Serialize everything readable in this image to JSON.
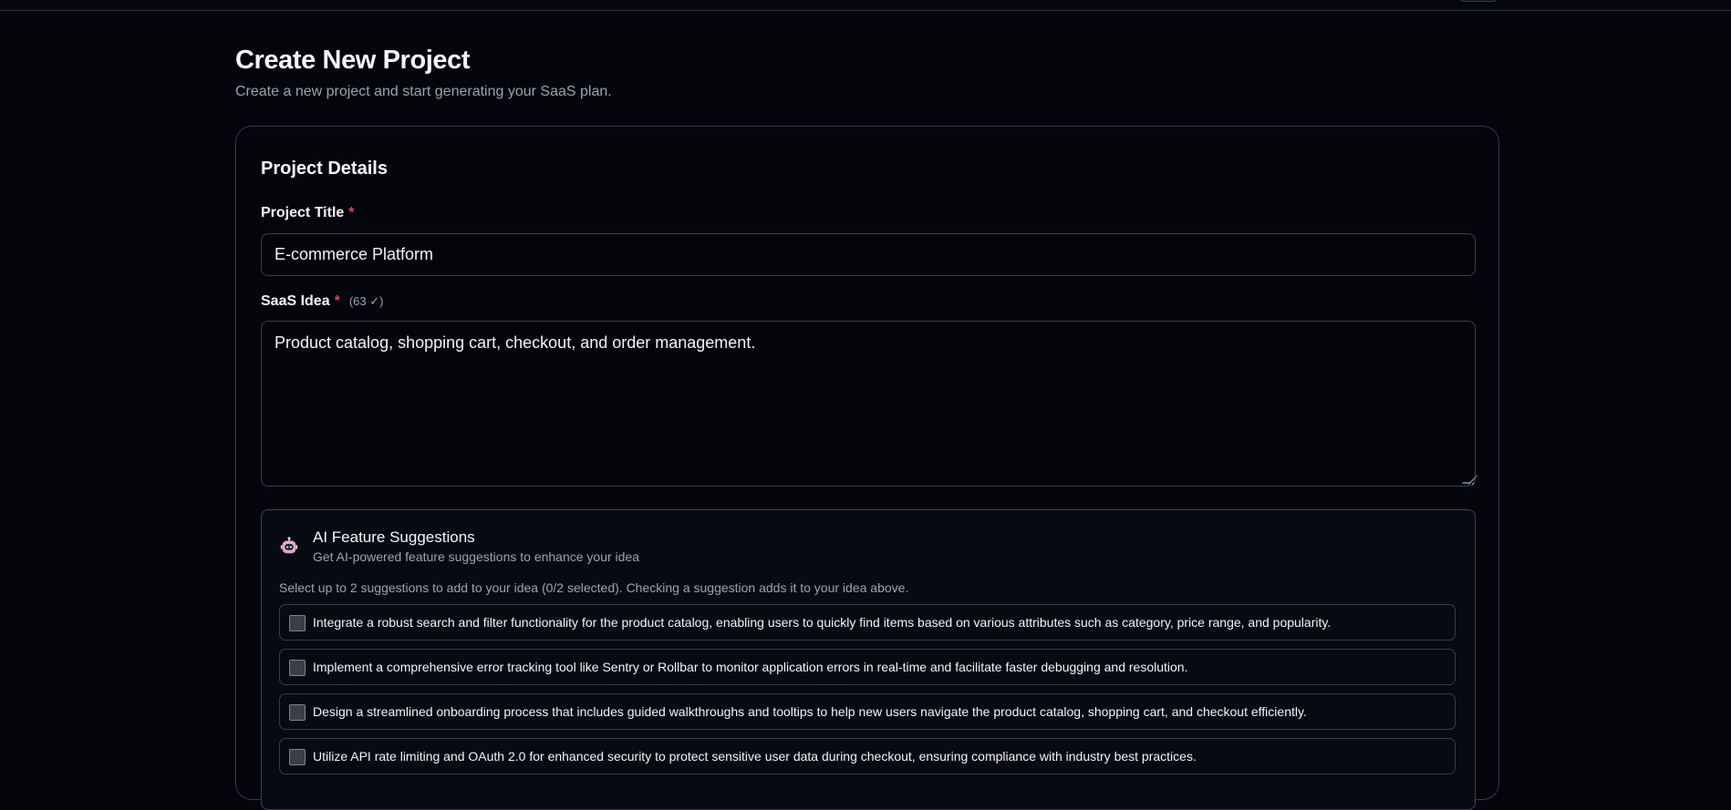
{
  "page": {
    "title": "Create New Project",
    "subtitle": "Create a new project and start generating your SaaS plan."
  },
  "card": {
    "title": "Project Details"
  },
  "fields": {
    "project_title": {
      "label": "Project Title",
      "required_marker": "*",
      "value": "E-commerce Platform"
    },
    "saas_idea": {
      "label": "SaaS Idea",
      "required_marker": "*",
      "char_count": "(63 ✓)",
      "value": "Product catalog, shopping cart, checkout, and order management."
    }
  },
  "ai_suggestions": {
    "title": "AI Feature Suggestions",
    "subtitle": "Get AI-powered feature suggestions to enhance your idea",
    "instructions": "Select up to 2 suggestions to add to your idea (0/2 selected). Checking a suggestion adds it to your idea above.",
    "items": [
      {
        "text": "Integrate a robust search and filter functionality for the product catalog, enabling users to quickly find items based on various attributes such as category, price range, and popularity.",
        "checked": false
      },
      {
        "text": "Implement a comprehensive error tracking tool like Sentry or Rollbar to monitor application errors in real-time and facilitate faster debugging and resolution.",
        "checked": false
      },
      {
        "text": "Design a streamlined onboarding process that includes guided walkthroughs and tooltips to help new users navigate the product catalog, shopping cart, and checkout efficiently.",
        "checked": false
      },
      {
        "text": "Utilize API rate limiting and OAuth 2.0 for enhanced security to protect sensitive user data during checkout, ensuring compliance with industry best practices.",
        "checked": false
      }
    ]
  },
  "icons": {
    "ai": "robot-icon"
  },
  "colors": {
    "background": "#03050a",
    "border": "#343944",
    "required": "#ef4444",
    "muted_text": "#9ca3af"
  }
}
